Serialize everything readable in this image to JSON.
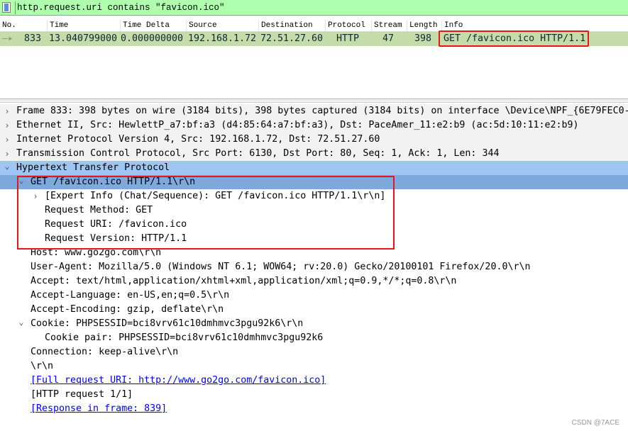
{
  "filter": {
    "value": "http.request.uri contains \"favicon.ico\"",
    "bg_color": "#afffaf"
  },
  "packet_list": {
    "columns": [
      "No.",
      "Time",
      "Time Delta",
      "Source",
      "Destination",
      "Protocol",
      "Stream",
      "Length",
      "Info"
    ],
    "rows": [
      {
        "no": "833",
        "time": "13.040799000",
        "delta": "0.000000000",
        "source": "192.168.1.72",
        "destination": "72.51.27.60",
        "protocol": "HTTP",
        "stream": "47",
        "length": "398",
        "info": "GET /favicon.ico HTTP/1.1",
        "row_color": "#c4dcaa",
        "highlighted": true
      }
    ]
  },
  "details": [
    {
      "text": "Frame 833: 398 bytes on wire (3184 bits), 398 bytes captured (3184 bits) on interface \\Device\\NPF_{6E79FEC0-",
      "level": 0,
      "exp": "collapsed",
      "style": "hdr"
    },
    {
      "text": "Ethernet II, Src: HewlettP_a7:bf:a3 (d4:85:64:a7:bf:a3), Dst: PaceAmer_11:e2:b9 (ac:5d:10:11:e2:b9)",
      "level": 0,
      "exp": "collapsed",
      "style": "hdr"
    },
    {
      "text": "Internet Protocol Version 4, Src: 192.168.1.72, Dst: 72.51.27.60",
      "level": 0,
      "exp": "collapsed",
      "style": "hdr"
    },
    {
      "text": "Transmission Control Protocol, Src Port: 6130, Dst Port: 80, Seq: 1, Ack: 1, Len: 344",
      "level": 0,
      "exp": "collapsed",
      "style": "hdr"
    },
    {
      "text": "Hypertext Transfer Protocol",
      "level": 0,
      "exp": "expanded",
      "style": "sel-parent"
    },
    {
      "text": "GET /favicon.ico HTTP/1.1\\r\\n",
      "level": 1,
      "exp": "expanded",
      "style": "sel"
    },
    {
      "text": "[Expert Info (Chat/Sequence): GET /favicon.ico HTTP/1.1\\r\\n]",
      "level": 2,
      "exp": "collapsed",
      "style": ""
    },
    {
      "text": "Request Method: GET",
      "level": 2,
      "exp": "",
      "style": ""
    },
    {
      "text": "Request URI: /favicon.ico",
      "level": 2,
      "exp": "",
      "style": ""
    },
    {
      "text": "Request Version: HTTP/1.1",
      "level": 2,
      "exp": "",
      "style": ""
    },
    {
      "text": "Host: www.go2go.com\\r\\n",
      "level": 1,
      "exp": "",
      "style": ""
    },
    {
      "text": "User-Agent: Mozilla/5.0 (Windows NT 6.1; WOW64; rv:20.0) Gecko/20100101 Firefox/20.0\\r\\n",
      "level": 1,
      "exp": "",
      "style": ""
    },
    {
      "text": "Accept: text/html,application/xhtml+xml,application/xml;q=0.9,*/*;q=0.8\\r\\n",
      "level": 1,
      "exp": "",
      "style": ""
    },
    {
      "text": "Accept-Language: en-US,en;q=0.5\\r\\n",
      "level": 1,
      "exp": "",
      "style": ""
    },
    {
      "text": "Accept-Encoding: gzip, deflate\\r\\n",
      "level": 1,
      "exp": "",
      "style": ""
    },
    {
      "text": "Cookie: PHPSESSID=bci8vrv61c10dmhmvc3pgu92k6\\r\\n",
      "level": 1,
      "exp": "expanded",
      "style": ""
    },
    {
      "text": "Cookie pair: PHPSESSID=bci8vrv61c10dmhmvc3pgu92k6",
      "level": 2,
      "exp": "",
      "style": ""
    },
    {
      "text": "Connection: keep-alive\\r\\n",
      "level": 1,
      "exp": "",
      "style": ""
    },
    {
      "text": "\\r\\n",
      "level": 1,
      "exp": "",
      "style": ""
    },
    {
      "text": "[Full request URI: http://www.go2go.com/favicon.ico]",
      "level": 1,
      "exp": "",
      "style": "link"
    },
    {
      "text": "[HTTP request 1/1]",
      "level": 1,
      "exp": "",
      "style": ""
    },
    {
      "text": "[Response in frame: 839]",
      "level": 1,
      "exp": "",
      "style": "link"
    }
  ],
  "watermark": "CSDN @7ACE"
}
